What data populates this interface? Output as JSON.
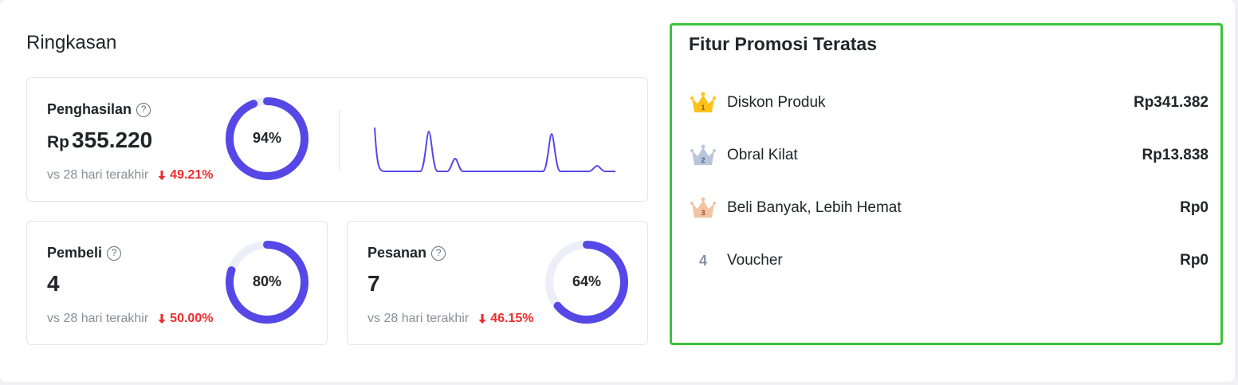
{
  "summary": {
    "title": "Ringkasan",
    "revenue": {
      "label": "Penghasilan",
      "help": "?",
      "currency": "Rp",
      "value": "355.220",
      "compare": "vs 28 hari terakhir",
      "change": "49.21%",
      "donut_percent": 94,
      "donut_label": "94%"
    },
    "buyers": {
      "label": "Pembeli",
      "help": "?",
      "value": "4",
      "compare": "vs 28 hari terakhir",
      "change": "50.00%",
      "donut_percent": 80,
      "donut_label": "80%"
    },
    "orders": {
      "label": "Pesanan",
      "help": "?",
      "value": "7",
      "compare": "vs 28 hari terakhir",
      "change": "46.15%",
      "donut_percent": 64,
      "donut_label": "64%"
    }
  },
  "promo": {
    "title": "Fitur Promosi Teratas",
    "items": [
      {
        "rank": "1",
        "rank_icon": "gold-crown-icon",
        "name": "Diskon Produk",
        "value": "Rp341.382"
      },
      {
        "rank": "2",
        "rank_icon": "silver-crown-icon",
        "name": "Obral Kilat",
        "value": "Rp13.838"
      },
      {
        "rank": "3",
        "rank_icon": "bronze-crown-icon",
        "name": "Beli Banyak, Lebih Hemat",
        "value": "Rp0"
      },
      {
        "rank": "4",
        "rank_icon": "",
        "name": "Voucher",
        "value": "Rp0"
      }
    ]
  },
  "colors": {
    "accent": "#5548e6",
    "track": "#eceef8",
    "negative": "#ee2b2b",
    "highlight_border": "#3dc238"
  }
}
